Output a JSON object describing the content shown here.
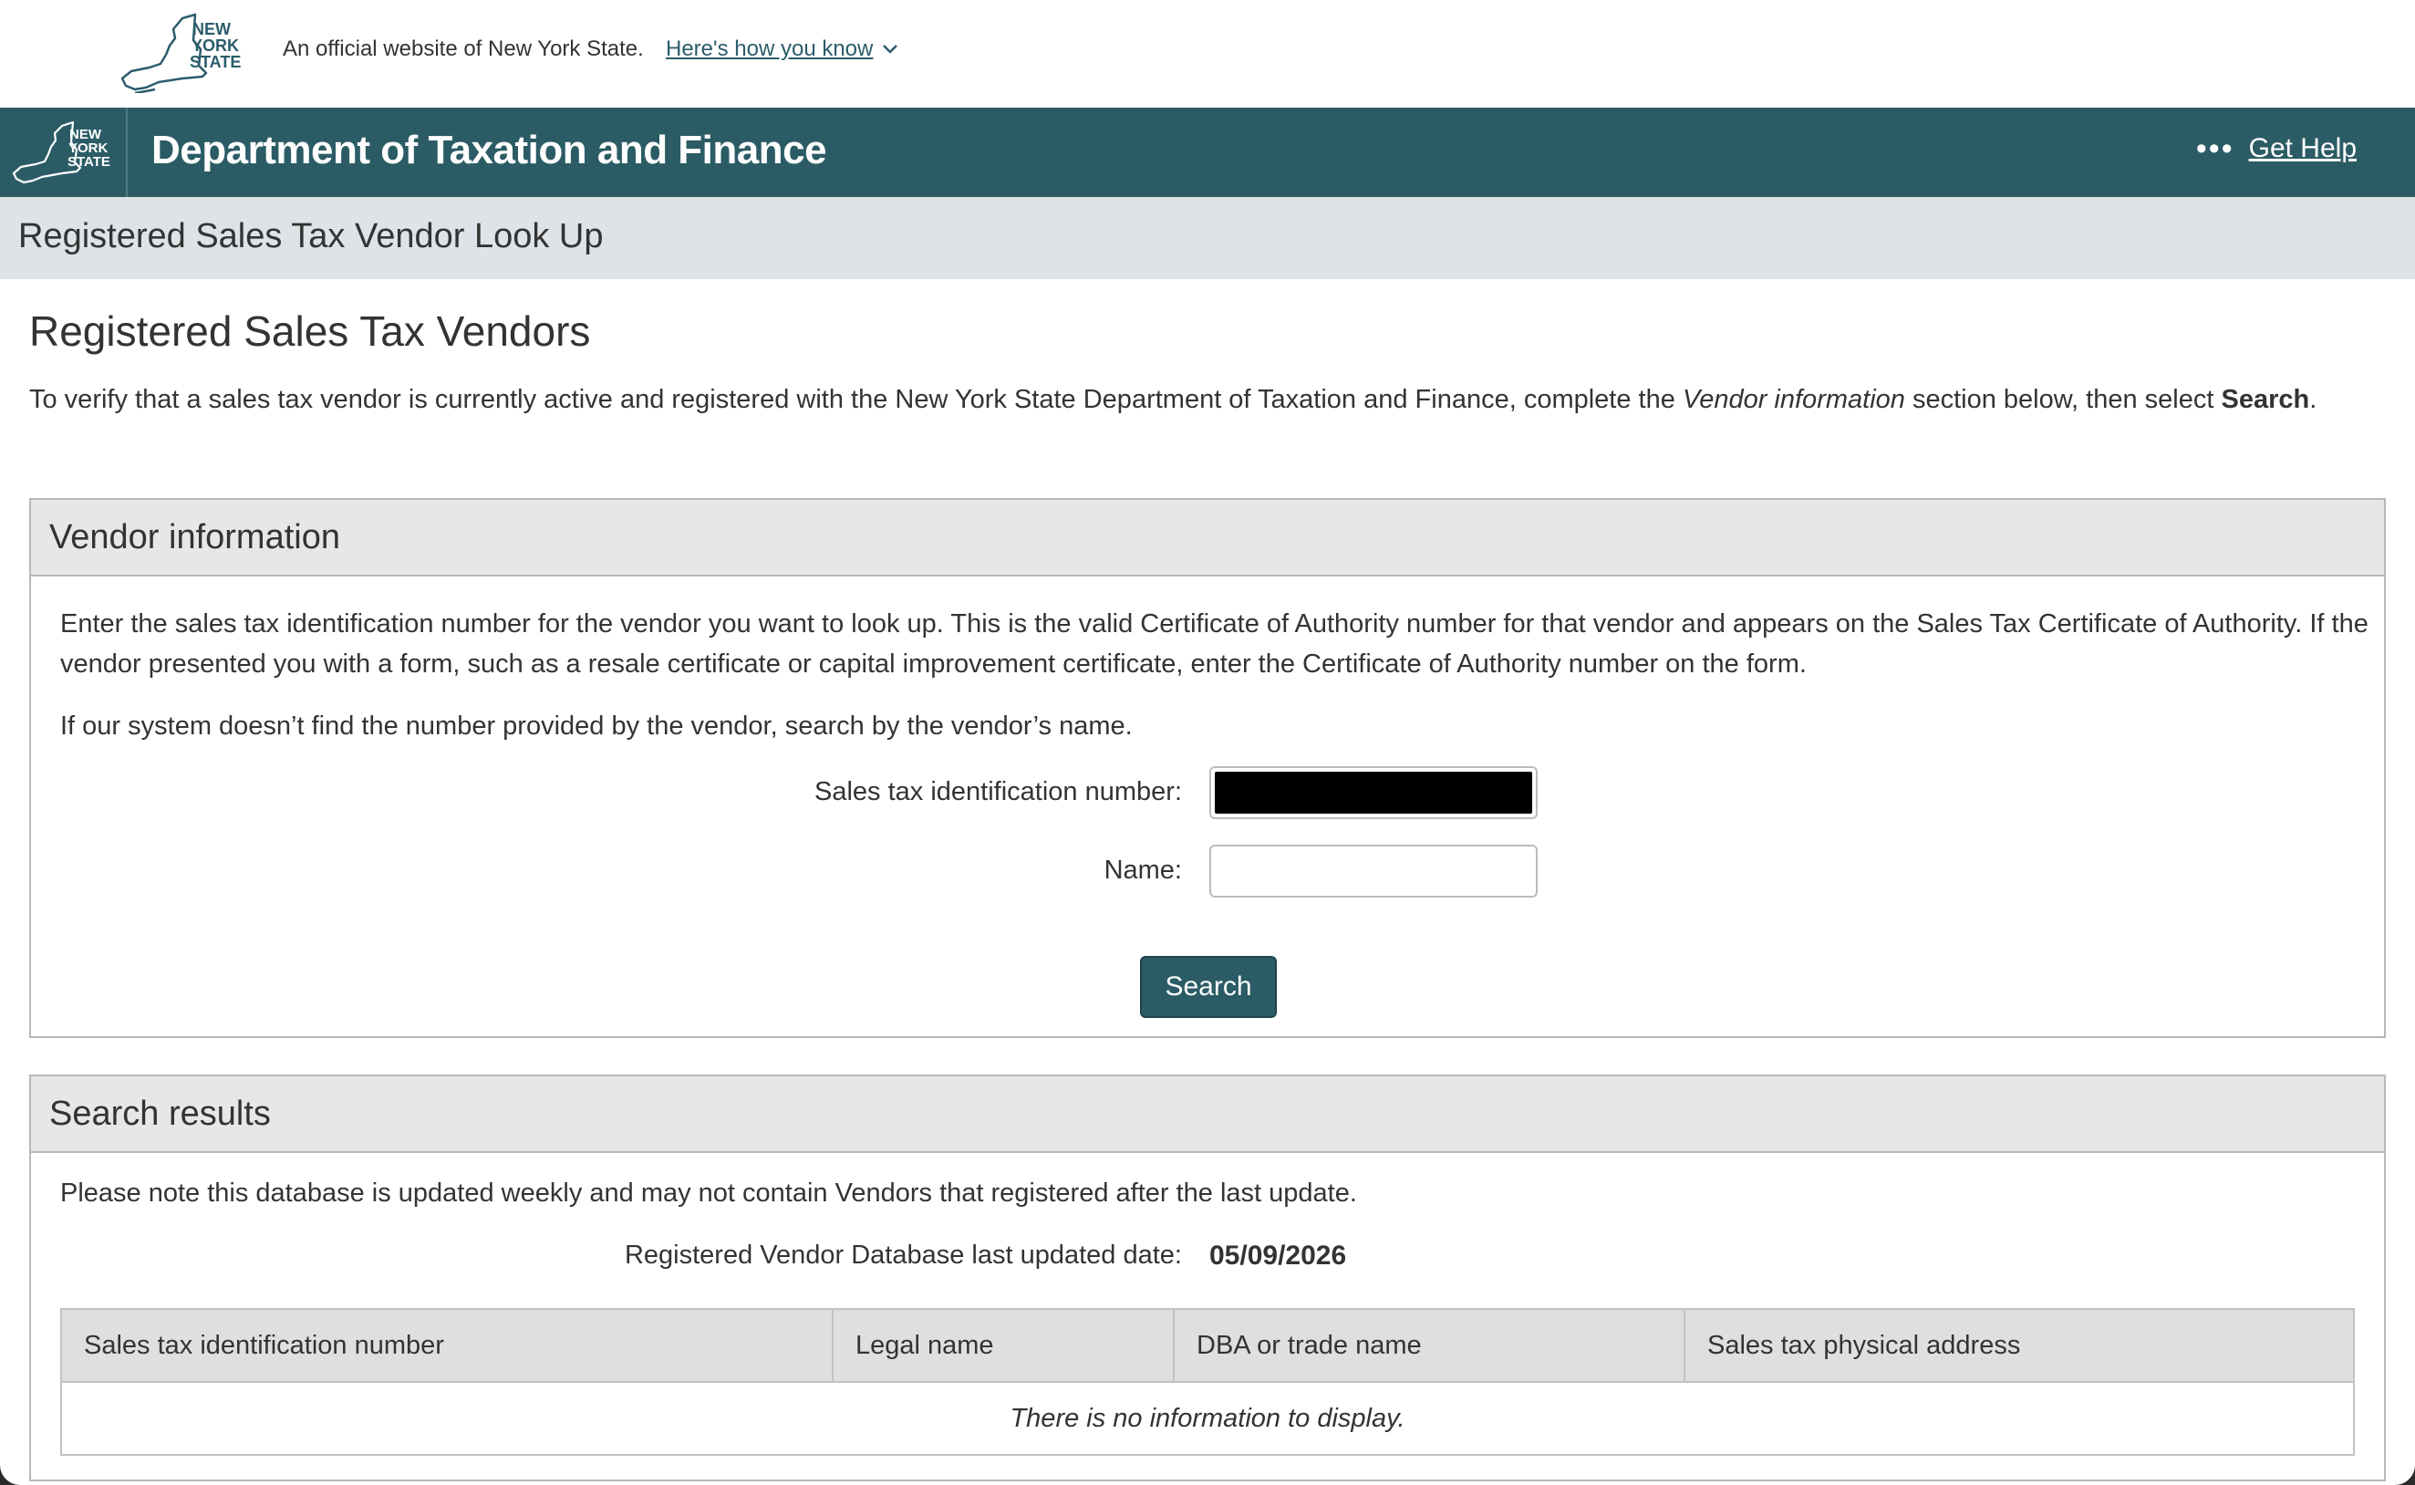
{
  "banner": {
    "logo_text": [
      "NEW",
      "YORK",
      "STATE"
    ],
    "official_text": "An official website of New York State.",
    "how_link": "Here's how you know"
  },
  "header": {
    "agency_title": "Department of Taxation and Finance",
    "help_label": "Get Help"
  },
  "subheader": {
    "title": "Registered Sales Tax Vendor Look Up"
  },
  "main": {
    "heading": "Registered Sales Tax Vendors",
    "intro_pre": "To verify that a sales tax vendor is currently active and registered with the New York State Department of Taxation and Finance, complete the ",
    "intro_em": "Vendor information",
    "intro_mid": " section below, then select ",
    "intro_strong": "Search",
    "intro_post": "."
  },
  "vendor_panel": {
    "title": "Vendor information",
    "para1": "Enter the sales tax identification number for the vendor you want to look up. This is the valid Certificate of Authority number for that vendor and appears on the Sales Tax Certificate of Authority. If the vendor presented you with a form, such as a resale certificate or capital improvement certificate, enter the Certificate of Authority number on the form.",
    "para2": "If our system doesn’t find the number provided by the vendor, search by the vendor’s name.",
    "id_label": "Sales tax identification number:",
    "name_label": "Name:",
    "name_value": "",
    "search_label": "Search"
  },
  "results_panel": {
    "title": "Search results",
    "note": "Please note this database is updated weekly and may not contain Vendors that registered after the last update.",
    "updated_label": "Registered Vendor Database last updated date:",
    "updated_value": "05/09/2026",
    "columns": [
      "Sales tax identification number",
      "Legal name",
      "DBA or trade name",
      "Sales tax physical address"
    ],
    "empty_message": "There is no information to display."
  },
  "colors": {
    "brand": "#2b5c65",
    "subheader_bg": "#dde3e6",
    "panel_header_bg": "#e7e7e5"
  }
}
